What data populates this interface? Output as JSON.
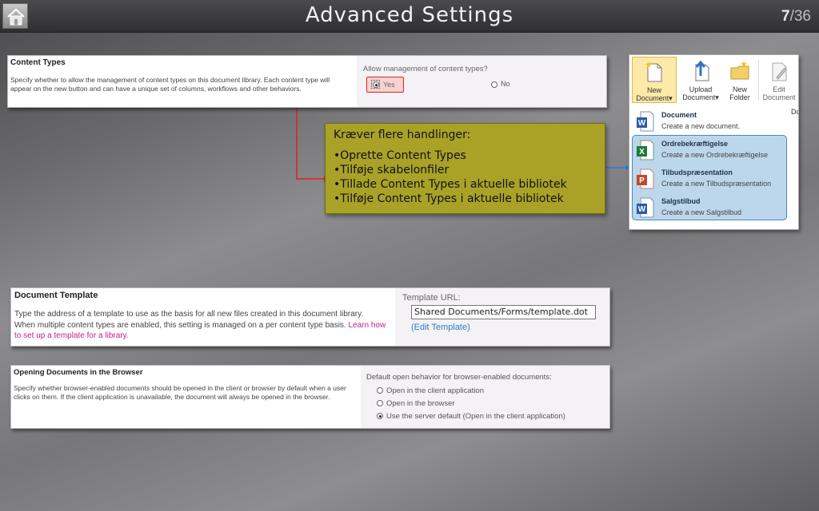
{
  "header": {
    "title": "Advanced Settings",
    "slide_current": "7",
    "slide_total": "/36"
  },
  "content_types": {
    "title": "Content Types",
    "description": "Specify whether to allow the management of content types on this document library. Each content type will appear on the new button and can have a unique set of columns, workflows and other behaviors.",
    "question": "Allow management of content types?",
    "yes_label": "Yes",
    "no_label": "No",
    "selected": "Yes"
  },
  "callout": {
    "heading": "Kræver flere handlinger:",
    "items": [
      "Oprette Content Types",
      "Tilføje skabelonfiler",
      "Tillade Content Types i aktuelle bibliotek",
      "Tilføje Content Types i aktuelle bibliotek"
    ]
  },
  "ribbon": {
    "buttons": [
      {
        "line1": "New",
        "line2": "Document"
      },
      {
        "line1": "Upload",
        "line2": "Document"
      },
      {
        "line1": "New",
        "line2": "Folder"
      },
      {
        "line1": "Edit",
        "line2": "Document"
      }
    ],
    "tail": "Dc",
    "menu": [
      {
        "title": "Document",
        "subtitle": "Create a new document.",
        "icon": "word-doc-icon"
      },
      {
        "title": "Ordrebekræftigelse",
        "subtitle": "Create a new Ordrebekræftigelse",
        "icon": "excel-doc-icon"
      },
      {
        "title": "Tilbudspræsentation",
        "subtitle": "Create a new Tilbudspræsentation",
        "icon": "powerpoint-doc-icon"
      },
      {
        "title": "Salgstilbud",
        "subtitle": "Create a new Salgstilbud",
        "icon": "word-doc-icon"
      }
    ]
  },
  "document_template": {
    "title": "Document Template",
    "description": "Type the address of a template to use as the basis for all new files created in this document library. When multiple content types are enabled, this setting is managed on a per content type basis.",
    "link_text": "Learn how to set up a template for a library.",
    "url_label": "Template URL:",
    "url_value": "Shared Documents/Forms/template.dot",
    "edit_link": "(Edit Template)"
  },
  "opening_documents": {
    "title": "Opening Documents in the Browser",
    "description": "Specify whether browser-enabled documents should be opened in the client or browser by default when a user clicks on them. If the client application is unavailable, the document will always be opened in the browser.",
    "label": "Default open behavior for browser-enabled documents:",
    "options": [
      "Open in the client application",
      "Open in the browser",
      "Use the server default (Open in the client application)"
    ],
    "selected_index": 2
  },
  "colors": {
    "callout_bg": "#aaa227",
    "highlight_red": "#dd2222",
    "highlight_blue": "#4a86c4",
    "link_magenta": "#c01f8a",
    "link_blue": "#2b7dc4"
  }
}
